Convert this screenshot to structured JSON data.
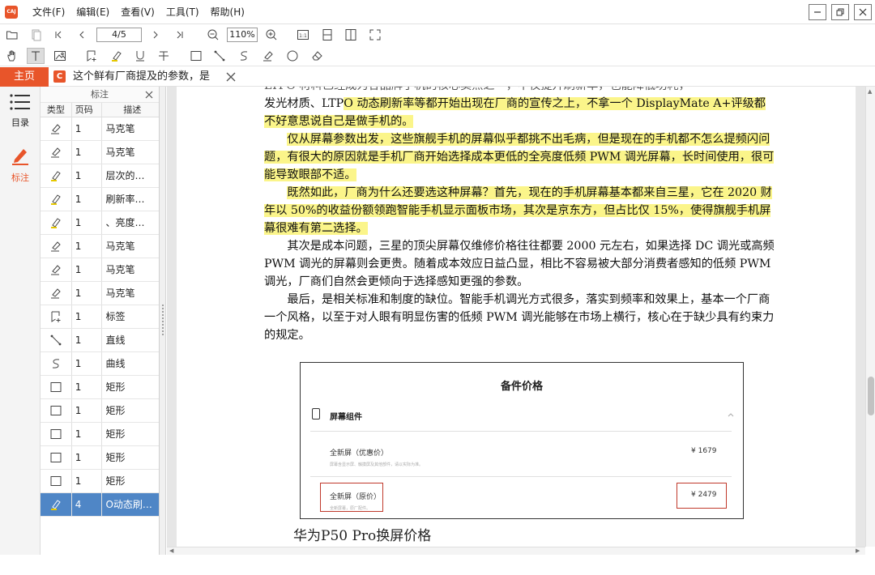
{
  "menu": {
    "items": [
      "文件(F)",
      "编辑(E)",
      "查看(V)",
      "工具(T)",
      "帮助(H)"
    ]
  },
  "app_logo_text": "CAJ",
  "toolbar": {
    "page_value": "4/5",
    "zoom_value": "110%"
  },
  "tabs": {
    "home_label": "主页",
    "doc_icon_letter": "C",
    "doc_title": "这个鲜有厂商提及的参数，是"
  },
  "sidebar": {
    "toc_label": "目录",
    "annotations_label": "标注"
  },
  "annotation_panel": {
    "title": "标注",
    "columns": [
      "类型",
      "页码",
      "描述"
    ],
    "rows": [
      {
        "icon": "marker-icon",
        "page": "1",
        "desc": "马克笔"
      },
      {
        "icon": "marker-icon",
        "page": "1",
        "desc": "马克笔"
      },
      {
        "icon": "highlighter-icon",
        "page": "1",
        "desc": "层次的…"
      },
      {
        "icon": "highlighter-icon",
        "page": "1",
        "desc": "刷新率…"
      },
      {
        "icon": "highlighter-icon",
        "page": "1",
        "desc": "、亮度…"
      },
      {
        "icon": "marker-icon",
        "page": "1",
        "desc": "马克笔"
      },
      {
        "icon": "marker-icon",
        "page": "1",
        "desc": "马克笔"
      },
      {
        "icon": "marker-icon",
        "page": "1",
        "desc": "马克笔"
      },
      {
        "icon": "bookmark-icon",
        "page": "1",
        "desc": "标签"
      },
      {
        "icon": "line-icon",
        "page": "1",
        "desc": "直线"
      },
      {
        "icon": "curve-icon",
        "page": "1",
        "desc": "曲线"
      },
      {
        "icon": "rectangle-icon",
        "page": "1",
        "desc": "矩形"
      },
      {
        "icon": "rectangle-icon",
        "page": "1",
        "desc": "矩形"
      },
      {
        "icon": "rectangle-icon",
        "page": "1",
        "desc": "矩形"
      },
      {
        "icon": "rectangle-icon",
        "page": "1",
        "desc": "矩形"
      },
      {
        "icon": "rectangle-icon",
        "page": "1",
        "desc": "矩形"
      },
      {
        "icon": "highlighter-icon",
        "page": "4",
        "desc": "O动态刷…"
      }
    ],
    "selected_index": 16
  },
  "document": {
    "cut_line": "LTPO 材料已经成为各品牌手机的核心卖点之一，不仅提升刷新率，也能降低功耗，",
    "p1_normal": "发光材质、LTP",
    "p1_highlight_a": "O 动态刷新率等都开始出现在厂商的宣传之上，不拿一个 DisplayMate A+评级都",
    "p1_highlight_b": "不好意思说自己是做手机的。",
    "p2": "仅从屏幕参数出发，这些旗舰手机的屏幕似乎都挑不出毛病，但是现在的手机都不怎么提频闪问题，有很大的原因就是手机厂商开始选择成本更低的全亮度低频 PWM 调光屏幕，长时间使用，很可能导致眼部不适。",
    "p3": "既然如此，厂商为什么还要选这种屏幕？首先，现在的手机屏幕基本都来自三星，它在 2020 财年以 50%的收益份额领跑智能手机显示面板市场，其次是京东方，但占比仅 15%，使得旗舰手机屏幕很难有第二选择。",
    "p4": "其次是成本问题，三星的顶尖屏幕仅维修价格往往都要 2000 元左右，如果选择 DC 调光或高频 PWM 调光的屏幕则会更贵。随着成本效应日益凸显，相比不容易被大部分消费者感知的低频 PWM 调光，厂商们自然会更倾向于选择感知更强的参数。",
    "p5": "最后，是相关标准和制度的缺位。智能手机调光方式很多，落实到频率和效果上，基本一个厂商一个风格，以至于对人眼有明显伤害的低频 PWM 调光能够在市场上横行，核心在于缺少具有约束力的规定。"
  },
  "figure": {
    "title": "备件价格",
    "section": "屏幕组件",
    "item1_name": "全新屏（优惠价）",
    "item1_sub": "屏幕含显示屏、触摸屏及其他部件，请以实际为准。",
    "item1_price": "¥ 1679",
    "item2_name": "全新屏（原价）",
    "item2_sub": "全新屏幕，原厂配件。",
    "item2_price": "¥ 2479",
    "caption": "华为P50 Pro换屏价格"
  },
  "colors": {
    "accent": "#e8552a",
    "highlight": "#fbf58a",
    "selected_row": "#4f86c6"
  }
}
